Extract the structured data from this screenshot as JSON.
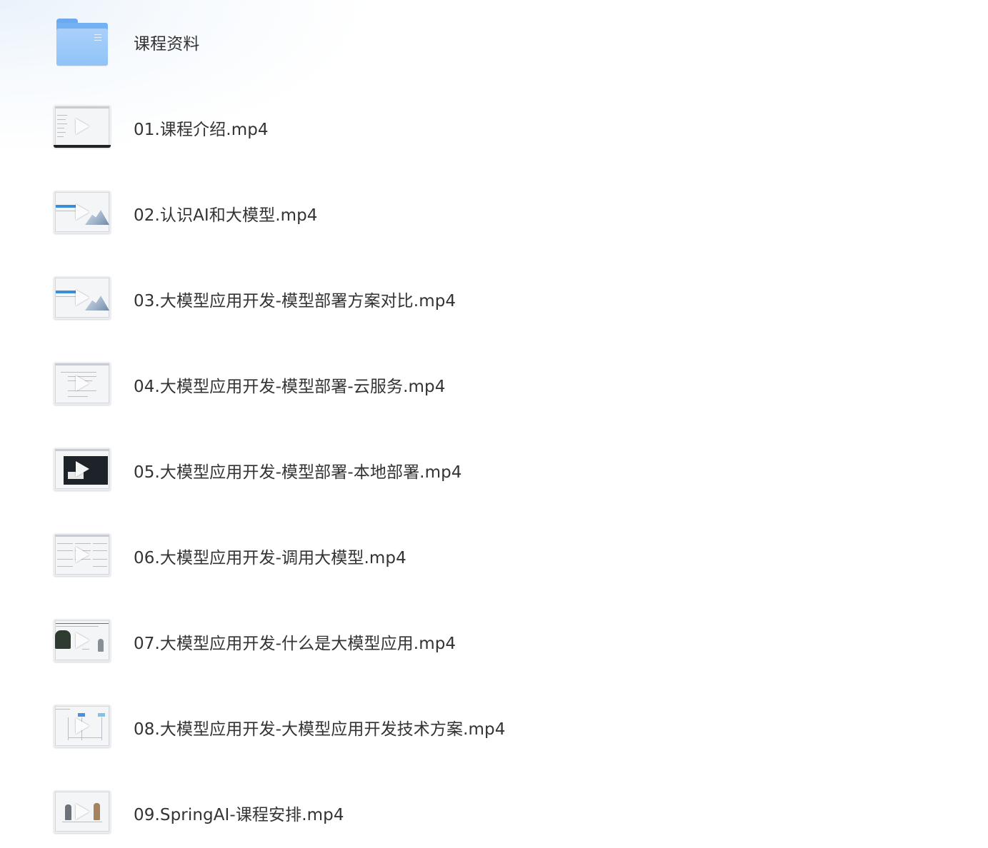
{
  "items": [
    {
      "type": "folder",
      "name": "课程资料",
      "icon": "folder-icon"
    },
    {
      "type": "video",
      "name": "01.课程介绍.mp4",
      "icon": "video-thumbnail"
    },
    {
      "type": "video",
      "name": "02.认识AI和大模型.mp4",
      "icon": "video-thumbnail"
    },
    {
      "type": "video",
      "name": "03.大模型应用开发-模型部署方案对比.mp4",
      "icon": "video-thumbnail"
    },
    {
      "type": "video",
      "name": "04.大模型应用开发-模型部署-云服务.mp4",
      "icon": "video-thumbnail"
    },
    {
      "type": "video",
      "name": "05.大模型应用开发-模型部署-本地部署.mp4",
      "icon": "video-thumbnail"
    },
    {
      "type": "video",
      "name": "06.大模型应用开发-调用大模型.mp4",
      "icon": "video-thumbnail"
    },
    {
      "type": "video",
      "name": "07.大模型应用开发-什么是大模型应用.mp4",
      "icon": "video-thumbnail"
    },
    {
      "type": "video",
      "name": "08.大模型应用开发-大模型应用开发技术方案.mp4",
      "icon": "video-thumbnail"
    },
    {
      "type": "video",
      "name": "09.SpringAI-课程安排.mp4",
      "icon": "video-thumbnail"
    }
  ],
  "colors": {
    "folder": "#91c3f8",
    "text": "#333333",
    "play": "#ffffff"
  }
}
